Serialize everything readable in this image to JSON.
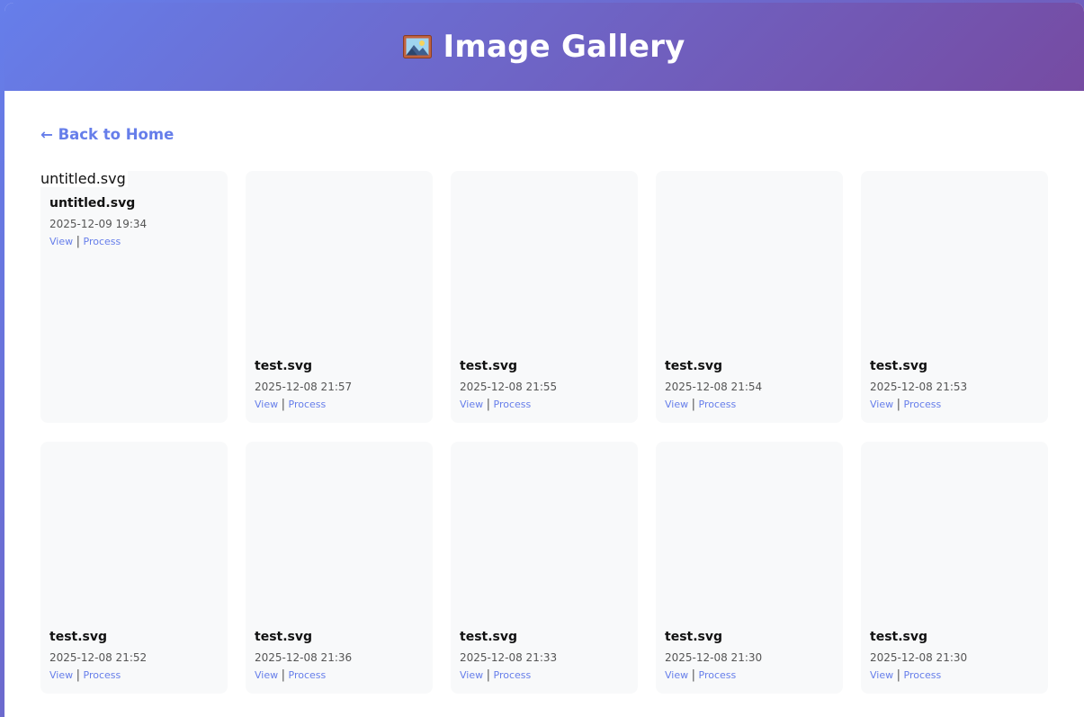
{
  "header": {
    "title": "Image Gallery",
    "icon": "framed-picture-icon"
  },
  "nav": {
    "back_label": "← Back to Home"
  },
  "gallery": {
    "view_label": "View",
    "process_label": "Process",
    "separator": "|",
    "items": [
      {
        "name": "untitled.svg",
        "date": "2025-12-09 19:34",
        "broken_alt": "untitled.svg"
      },
      {
        "name": "test.svg",
        "date": "2025-12-08 21:57"
      },
      {
        "name": "test.svg",
        "date": "2025-12-08 21:55"
      },
      {
        "name": "test.svg",
        "date": "2025-12-08 21:54"
      },
      {
        "name": "test.svg",
        "date": "2025-12-08 21:53"
      },
      {
        "name": "test.svg",
        "date": "2025-12-08 21:52"
      },
      {
        "name": "test.svg",
        "date": "2025-12-08 21:36"
      },
      {
        "name": "test.svg",
        "date": "2025-12-08 21:33"
      },
      {
        "name": "test.svg",
        "date": "2025-12-08 21:30"
      },
      {
        "name": "test.svg",
        "date": "2025-12-08 21:30"
      }
    ]
  },
  "colors": {
    "accent": "#667eea",
    "gradient_end": "#764ba2",
    "card_bg": "#f8f9fa"
  }
}
